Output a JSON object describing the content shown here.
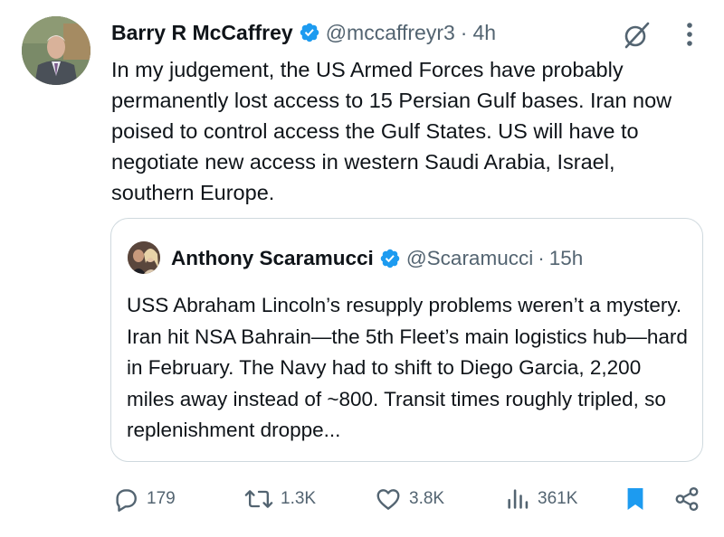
{
  "tweet": {
    "author_name": "Barry R McCaffrey",
    "handle": "@mccaffreyr3",
    "separator": "·",
    "time": "4h",
    "text": "In my judgement, the US Armed Forces have probably permanently lost access to 15 Persian Gulf bases. Iran now poised to control access the Gulf States. US will have to negotiate new access in western Saudi Arabia, Israel, southern Europe."
  },
  "quote": {
    "author_name": "Anthony Scaramucci",
    "handle": "@Scaramucci",
    "separator": "·",
    "time": "15h",
    "text": "USS Abraham Lincoln’s resupply problems weren’t a mystery. Iran hit NSA Bahrain—the 5th Fleet’s main logistics hub—hard in February. The Navy had to shift to Diego Garcia, 2,200 miles away instead of ~800. Transit times roughly tripled, so replenishment droppe..."
  },
  "actions": {
    "replies": "179",
    "reposts": "1.3K",
    "likes": "3.8K",
    "views": "361K"
  },
  "icons": {
    "verified": "verified-badge-icon",
    "grok": "grok-icon",
    "more": "more-options-icon",
    "reply": "reply-icon",
    "repost": "repost-icon",
    "like": "heart-icon",
    "views": "analytics-icon",
    "bookmark": "bookmark-icon",
    "share": "share-icon"
  },
  "colors": {
    "verified_blue": "#1d9bf0",
    "bookmark_blue": "#1d9bf0",
    "secondary_text": "#536471",
    "primary_text": "#0f1419",
    "border": "#cfd9de"
  }
}
